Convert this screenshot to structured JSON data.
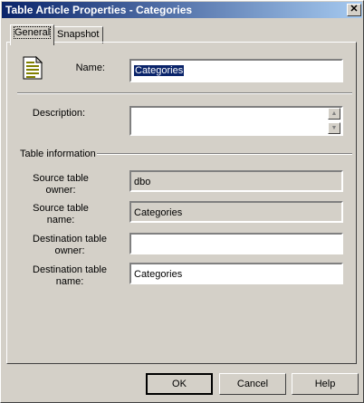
{
  "window": {
    "title": "Table Article Properties - Categories"
  },
  "tabs": [
    {
      "label": "General"
    },
    {
      "label": "Snapshot"
    }
  ],
  "general": {
    "name_label": "Name:",
    "name_value": "Categories",
    "description_label": "Description:",
    "description_value": "",
    "table_info_heading": "Table information",
    "source_owner_label_line1": "Source table",
    "source_owner_label_line2": "owner:",
    "source_owner_value": "dbo",
    "source_name_label_line1": "Source table",
    "source_name_label_line2": "name:",
    "source_name_value": "Categories",
    "dest_owner_label_line1": "Destination table",
    "dest_owner_label_line2": "owner:",
    "dest_owner_value": "",
    "dest_name_label_line1": "Destination table",
    "dest_name_label_line2": "name:",
    "dest_name_value": "Categories"
  },
  "buttons": {
    "ok": "OK",
    "cancel": "Cancel",
    "help": "Help"
  },
  "icons": {
    "article": "document-icon",
    "close": "close-icon"
  },
  "colors": {
    "titlebar_start": "#0a246a",
    "titlebar_end": "#a6caf0",
    "dialog": "#d4d0c8",
    "selection": "#0a246a"
  }
}
